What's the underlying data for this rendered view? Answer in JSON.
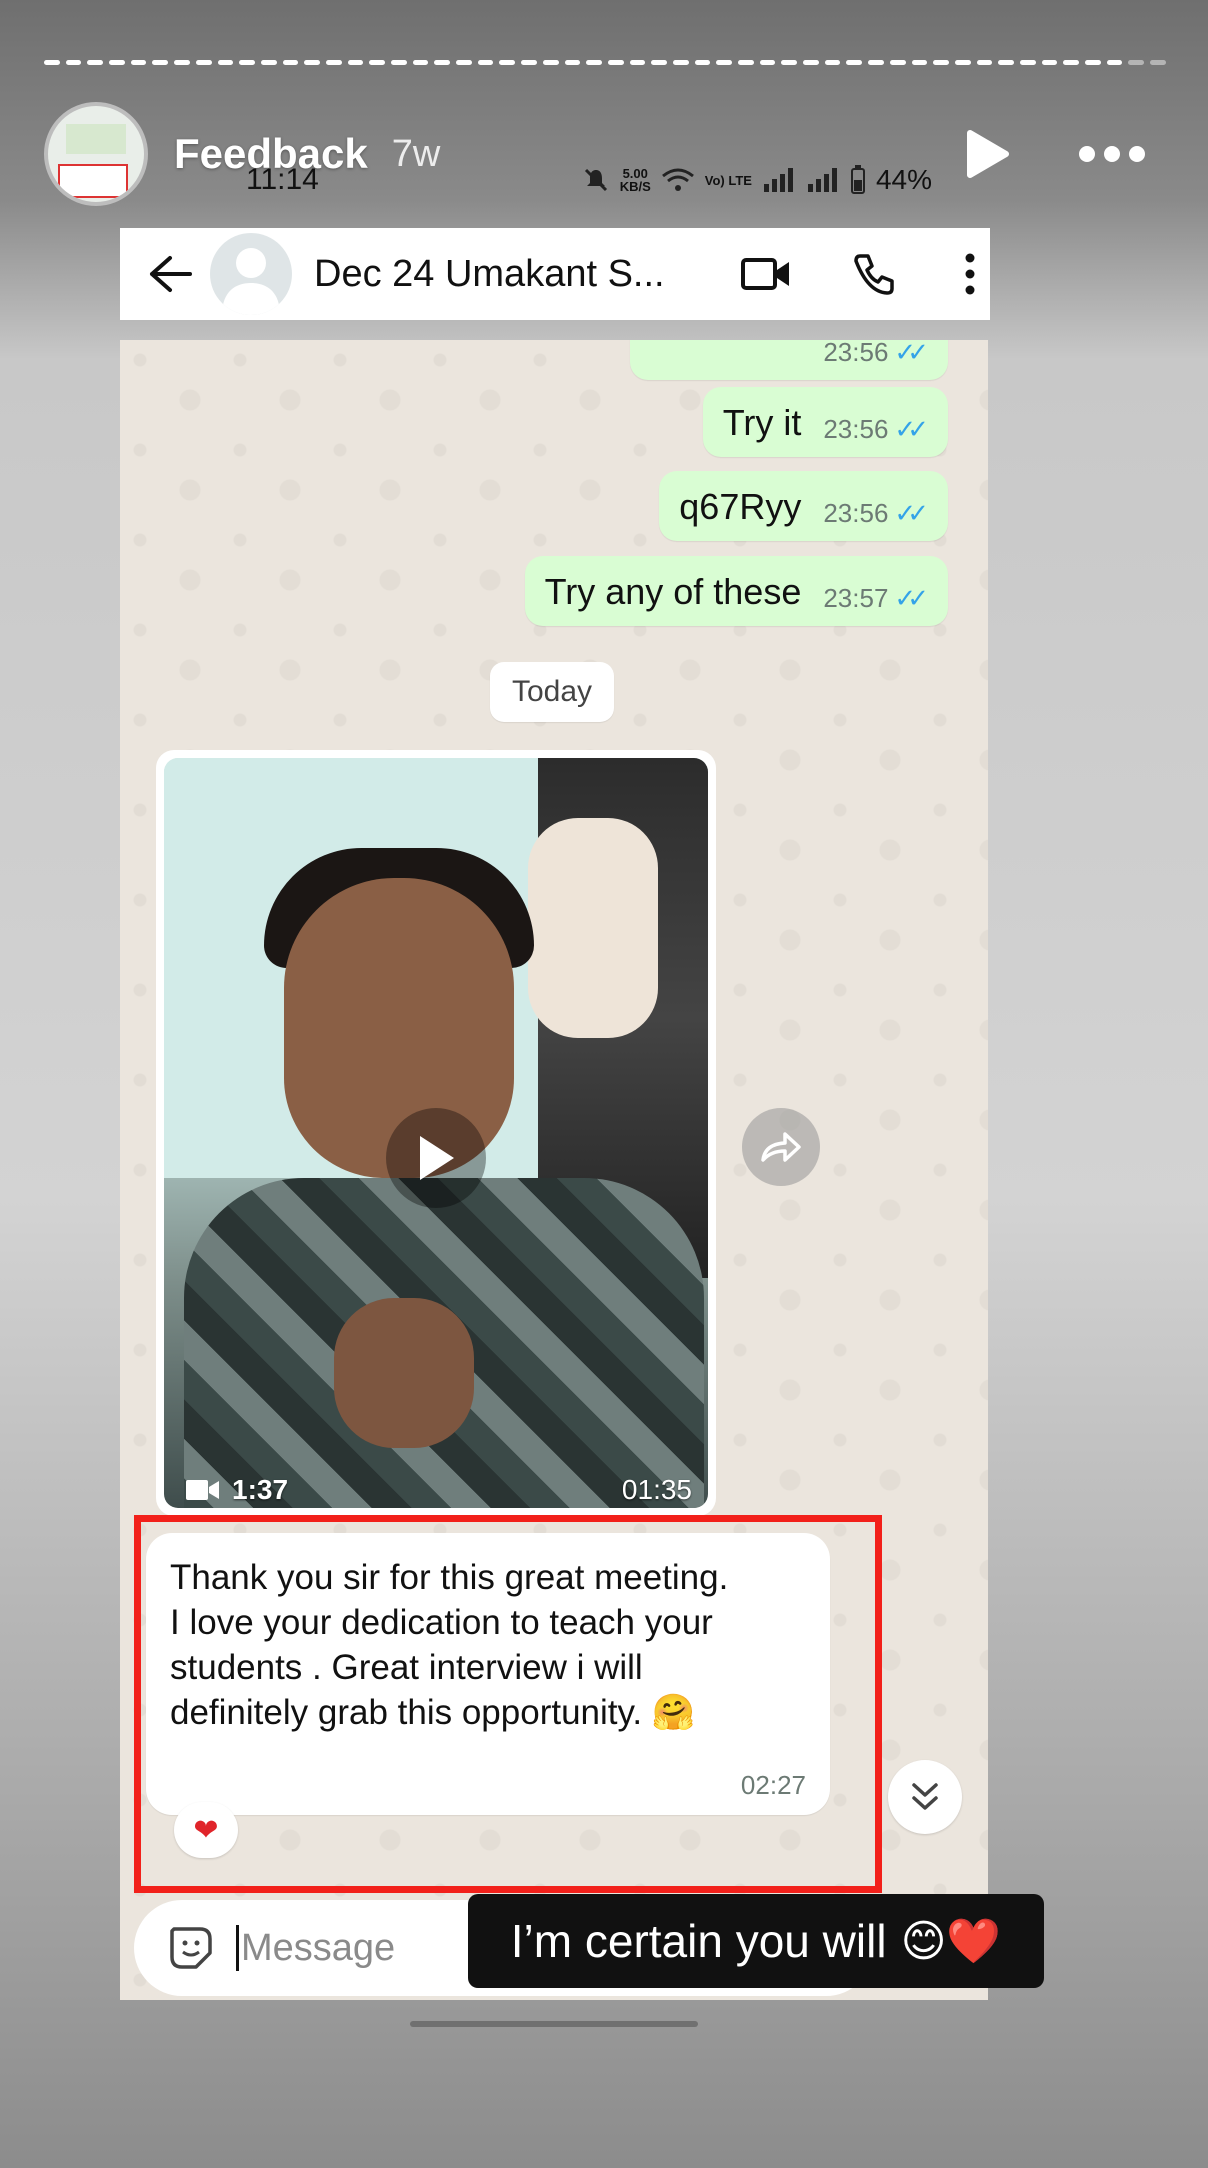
{
  "story": {
    "title": "Feedback",
    "age": "7w",
    "caption": "I’m certain you will",
    "caption_emojis": "😊❤️"
  },
  "phone_status": {
    "time": "11:14",
    "speed": "5.00",
    "speed_unit": "KB/S",
    "volte": "Vo) LTE",
    "battery": "44%"
  },
  "chat_header": {
    "contact_name": "Dec 24 Umakant S..."
  },
  "messages_out": [
    {
      "text": "",
      "time": "23:56",
      "status": "read"
    },
    {
      "text": "Try it",
      "time": "23:56",
      "status": "read"
    },
    {
      "text": "q67Ryy",
      "time": "23:56",
      "status": "read"
    },
    {
      "text": "Try any of these",
      "time": "23:57",
      "status": "read"
    }
  ],
  "day_separator": "Today",
  "video_message": {
    "duration": "1:37",
    "time": "01:35"
  },
  "message_in": {
    "text": "Thank you sir for this great meeting.\nI love your dedication to teach your\nstudents . Great interview i will\ndefinitely grab this opportunity. 🤗",
    "time": "02:27",
    "reaction": "❤"
  },
  "composer": {
    "placeholder": "Message"
  },
  "colors": {
    "outgoing_bubble": "#d9fdd3",
    "highlight": "#f2201a",
    "read_ticks": "#34a3e8"
  }
}
